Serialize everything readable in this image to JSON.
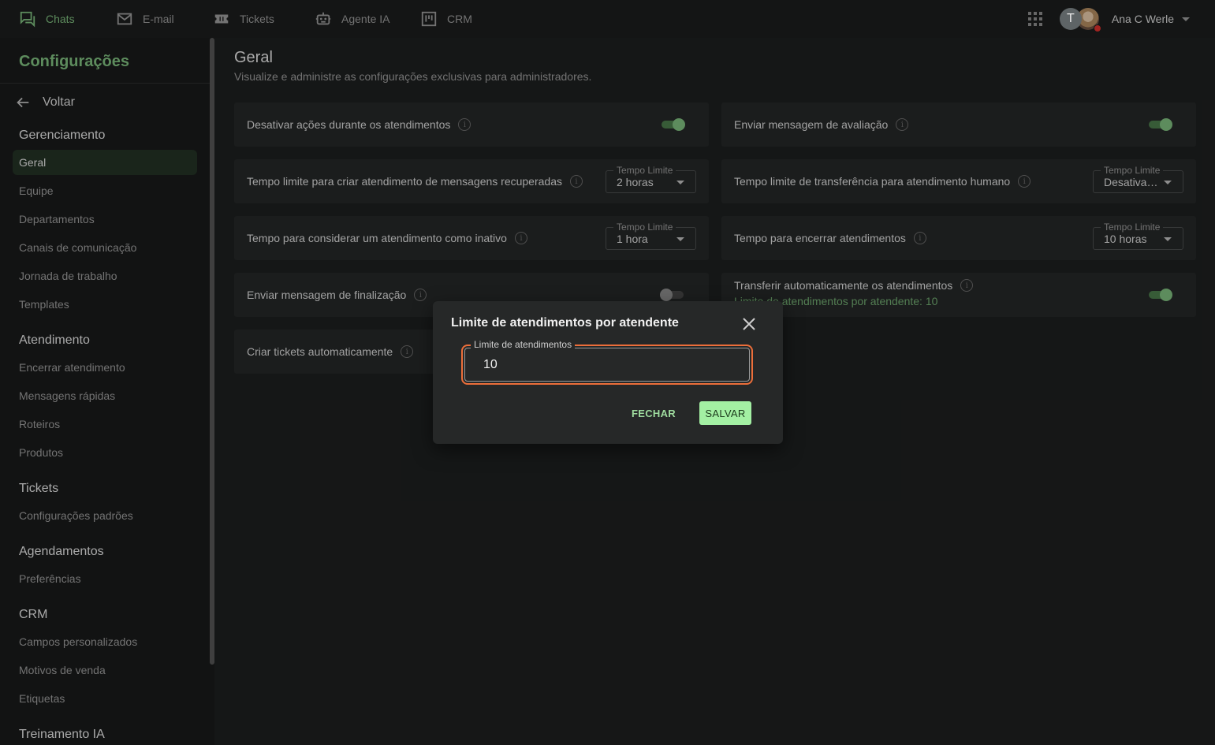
{
  "nav": {
    "items": [
      {
        "label": "Chats",
        "icon": "chat-icon",
        "active": true
      },
      {
        "label": "E-mail",
        "icon": "mail-icon"
      },
      {
        "label": "Tickets",
        "icon": "ticket-icon"
      },
      {
        "label": "Agente IA",
        "icon": "robot-icon"
      },
      {
        "label": "CRM",
        "icon": "kanban-icon"
      }
    ],
    "avatar_initial": "T",
    "user_name": "Ana C Werle"
  },
  "sidebar": {
    "title": "Configurações",
    "back_label": "Voltar",
    "sections": [
      {
        "heading": "Gerenciamento",
        "items": [
          "Geral",
          "Equipe",
          "Departamentos",
          "Canais de comunicação",
          "Jornada de trabalho",
          "Templates"
        ]
      },
      {
        "heading": "Atendimento",
        "items": [
          "Encerrar atendimento",
          "Mensagens rápidas",
          "Roteiros",
          "Produtos"
        ]
      },
      {
        "heading": "Tickets",
        "items": [
          "Configurações padrões"
        ]
      },
      {
        "heading": "Agendamentos",
        "items": [
          "Preferências"
        ]
      },
      {
        "heading": "CRM",
        "items": [
          "Campos personalizados",
          "Motivos de venda",
          "Etiquetas"
        ]
      },
      {
        "heading": "Treinamento IA",
        "items": []
      }
    ],
    "active_item": "Geral"
  },
  "main": {
    "title": "Geral",
    "subtitle": "Visualize e administre as configurações exclusivas para administradores.",
    "cards": [
      {
        "label": "Desativar ações durante os atendimentos",
        "control": "toggle",
        "on": true
      },
      {
        "label": "Enviar mensagem de avaliação",
        "control": "toggle",
        "on": true
      },
      {
        "label": "Tempo limite para criar atendimento de mensagens recuperadas",
        "control": "select",
        "legend": "Tempo Limite",
        "value": "2 horas"
      },
      {
        "label": "Tempo limite de transferência para atendimento humano",
        "control": "select",
        "legend": "Tempo Limite",
        "value": "Desativa…"
      },
      {
        "label": "Tempo para considerar um atendimento como inativo",
        "control": "select",
        "legend": "Tempo Limite",
        "value": "1 hora"
      },
      {
        "label": "Tempo para encerrar atendimentos",
        "control": "select",
        "legend": "Tempo Limite",
        "value": "10 horas"
      },
      {
        "label": "Enviar mensagem de finalização",
        "control": "toggle",
        "on": false
      },
      {
        "label": "Transferir automaticamente os atendimentos",
        "sub": "Limite de atendimentos por atendente: 10",
        "control": "toggle",
        "on": true
      },
      {
        "label": "Criar tickets automaticamente",
        "control": "none"
      }
    ]
  },
  "dialog": {
    "title": "Limite de atendimentos por atendente",
    "field_label": "Limite de atendimentos",
    "field_value": "10",
    "close_label": "FECHAR",
    "save_label": "SALVAR"
  },
  "colors": {
    "accent": "#7dbb7d",
    "focus_border": "#ec6e3a",
    "save_button": "#a3f0a3"
  }
}
